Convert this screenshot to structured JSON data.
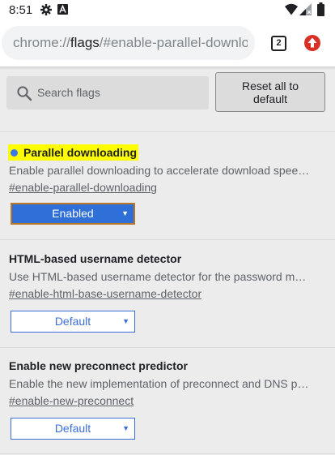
{
  "status_bar": {
    "time": "8:51"
  },
  "toolbar": {
    "url_scheme": "chrome://",
    "url_host": "flags",
    "url_rest": "/#enable-parallel-downloading",
    "tab_count": "2"
  },
  "search": {
    "placeholder": "Search flags",
    "reset_label": "Reset all to default"
  },
  "flags": [
    {
      "title": "Parallel downloading",
      "description": "Enable parallel downloading to accelerate download speed. – Mac, Windows, Linux, Chrome OS, Android",
      "link": "#enable-parallel-downloading",
      "state": "Enabled"
    },
    {
      "title": "HTML-based username detector",
      "description": "Use HTML-based username detector for the password manager. – Mac, Windows, Linux, Chrome OS, Android",
      "link": "#enable-html-base-username-detector",
      "state": "Default"
    },
    {
      "title": "Enable new preconnect predictor",
      "description": "Enable the new implementation of preconnect and DNS preresolve. – Mac, Windows, Linux, Chrome OS, Android",
      "link": "#enable-new-preconnect",
      "state": "Default"
    }
  ],
  "colors": {
    "highlight": "#ffff00",
    "accent_blue": "#2f6fd8",
    "update_red": "#d93025"
  }
}
